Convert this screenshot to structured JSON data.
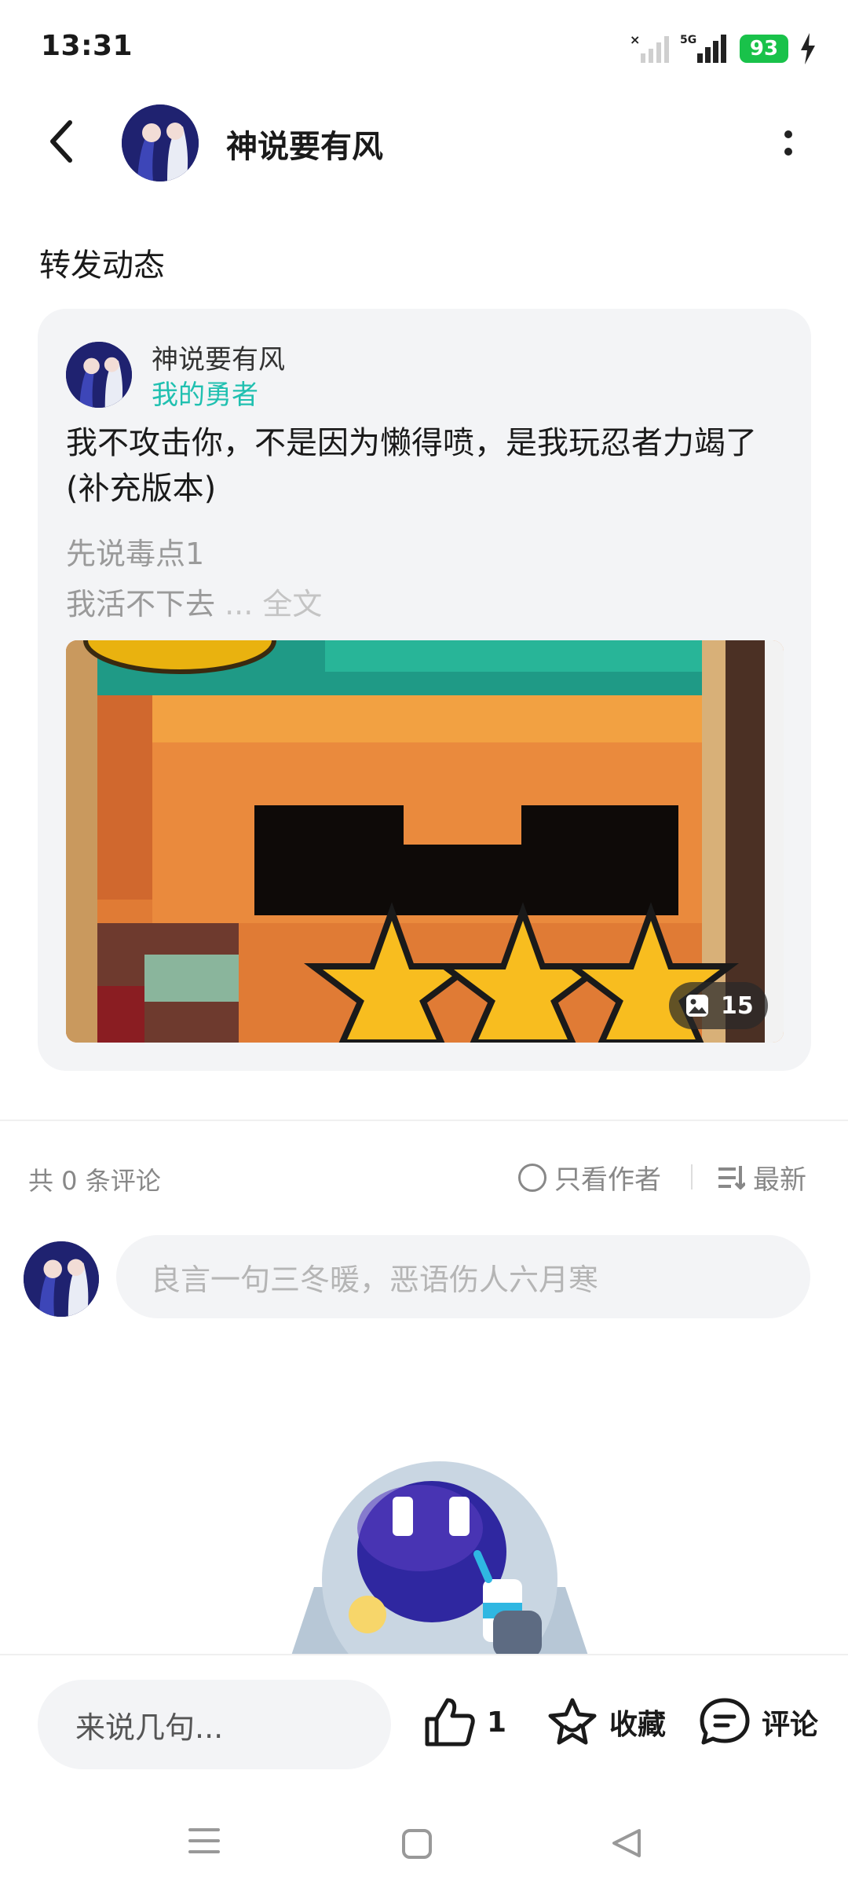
{
  "status": {
    "time": "13:31",
    "network": "5G",
    "battery": "93"
  },
  "header": {
    "username": "神说要有风"
  },
  "section_title": "转发动态",
  "post": {
    "author": "神说要有风",
    "tag": "我的勇者",
    "title": "我不攻击你，不是因为懒得喷，是我玩忍者力竭了(补充版本)",
    "excerpt_line1": "先说毒点1",
    "excerpt_line2": "我活不下去",
    "ellipsis": " ... ",
    "read_more": "全文",
    "image_count": "15"
  },
  "comments": {
    "count_label": "共 0 条评论",
    "author_only": "只看作者",
    "sort": "最新",
    "input_placeholder": "良言一句三冬暖，恶语伤人六月寒"
  },
  "bottom_bar": {
    "reply_placeholder": "来说几句...",
    "like_count": "1",
    "favorite": "收藏",
    "comment": "评论"
  },
  "colors": {
    "accent_tag": "#20c0b0",
    "battery": "#19c24a"
  }
}
